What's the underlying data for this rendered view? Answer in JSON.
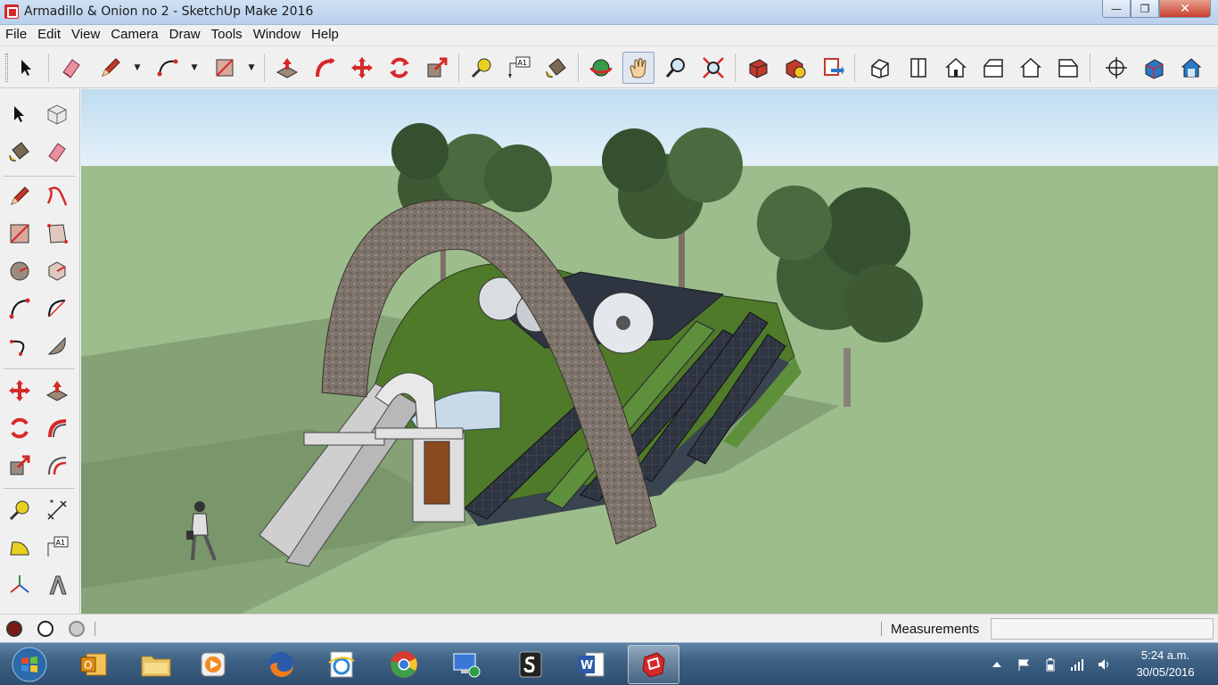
{
  "window": {
    "title": "Armadillo & Onion no 2 - SketchUp Make 2016",
    "minimize_glyph": "—",
    "maximize_glyph": "❐",
    "close_glyph": "✕"
  },
  "menu": [
    "File",
    "Edit",
    "View",
    "Camera",
    "Draw",
    "Tools",
    "Window",
    "Help"
  ],
  "toolbar": {
    "text_tool_label": "A1"
  },
  "left_toolbar": {
    "text_tool_label": "A1"
  },
  "statusbar": {
    "measurements_label": "Measurements",
    "measurements_value": ""
  },
  "taskbar": {
    "apps": [
      "outlook-icon",
      "file-explorer-icon",
      "media-player-icon",
      "firefox-icon",
      "internet-explorer-icon",
      "chrome-icon",
      "remote-desktop-icon",
      "sketchbook-icon",
      "word-icon",
      "sketchup-icon"
    ],
    "active_app": "sketchup-icon",
    "time": "5:24 a.m.",
    "date": "30/05/2016"
  },
  "colors": {
    "sky": "#cfe6f5",
    "ground": "#9dbe8c",
    "accent_red": "#d62828",
    "taskbar": "#3f6284"
  }
}
